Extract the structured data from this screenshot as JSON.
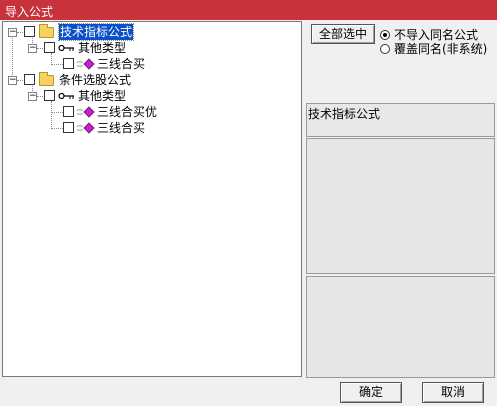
{
  "window": {
    "title": "导入公式"
  },
  "tree": {
    "root1": {
      "label": "技术指标公式"
    },
    "root1_child": {
      "label": "其他类型"
    },
    "root1_leaf1": {
      "label": "三线合买"
    },
    "root2": {
      "label": "条件选股公式"
    },
    "root2_child": {
      "label": "其他类型"
    },
    "root2_leaf1": {
      "label": "三线合买优"
    },
    "root2_leaf2": {
      "label": "三线合买"
    }
  },
  "options": {
    "select_all_label": "全部选中",
    "no_import_label": "不导入同名公式",
    "overwrite_label": "覆盖同名(非系统)",
    "selected": "no_import"
  },
  "detail": {
    "formula_type": "技术指标公式"
  },
  "footer": {
    "ok_label": "确定",
    "cancel_label": "取消"
  },
  "colors": {
    "titlebar": "#c8323a",
    "selection": "#0a50c8",
    "folder": "#f4d35e",
    "gem": "#c81ec8"
  }
}
